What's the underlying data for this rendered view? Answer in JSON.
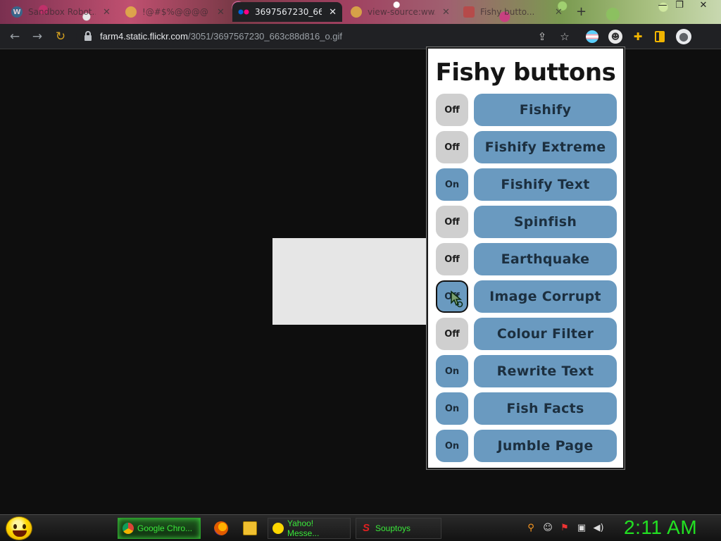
{
  "browser": {
    "tabs": [
      {
        "title": "Sandbox Robot...",
        "icon": "wordpress-icon"
      },
      {
        "title": "!@#$%@@@@",
        "icon": "smiley-icon"
      },
      {
        "title": "3697567230_663...",
        "icon": "flickr-icon"
      },
      {
        "title": "view-source:ww...",
        "icon": "smiley-icon"
      },
      {
        "title": "Fishy butto...",
        "icon": "fishy-icon"
      }
    ],
    "active_tab_index": 2,
    "url_host": "farm4.static.flickr.com",
    "url_path": "/3051/3697567230_663c88d816_o.gif",
    "colors": {
      "toolbar": "#202124",
      "accent": "#6a9ac0"
    }
  },
  "popup": {
    "title": "Fishy buttons",
    "rows": [
      {
        "state": "Off",
        "label": "Fishify"
      },
      {
        "state": "Off",
        "label": "Fishify Extreme"
      },
      {
        "state": "On",
        "label": "Fishify Text"
      },
      {
        "state": "Off",
        "label": "Spinfish"
      },
      {
        "state": "Off",
        "label": "Earthquake"
      },
      {
        "state": "Off",
        "label": "Image Corrupt"
      },
      {
        "state": "Off",
        "label": "Colour Filter"
      },
      {
        "state": "On",
        "label": "Rewrite Text"
      },
      {
        "state": "On",
        "label": "Fish Facts"
      },
      {
        "state": "On",
        "label": "Jumble Page"
      }
    ]
  },
  "taskbar": {
    "items": [
      {
        "label": "Google Chro...",
        "icon": "chrome-icon"
      },
      {
        "label": "Yahoo! Messe...",
        "icon": "yahoo-smiley-icon"
      },
      {
        "label": "Souptoys",
        "icon": "souptoys-icon"
      }
    ],
    "clock": "2:11 AM"
  }
}
